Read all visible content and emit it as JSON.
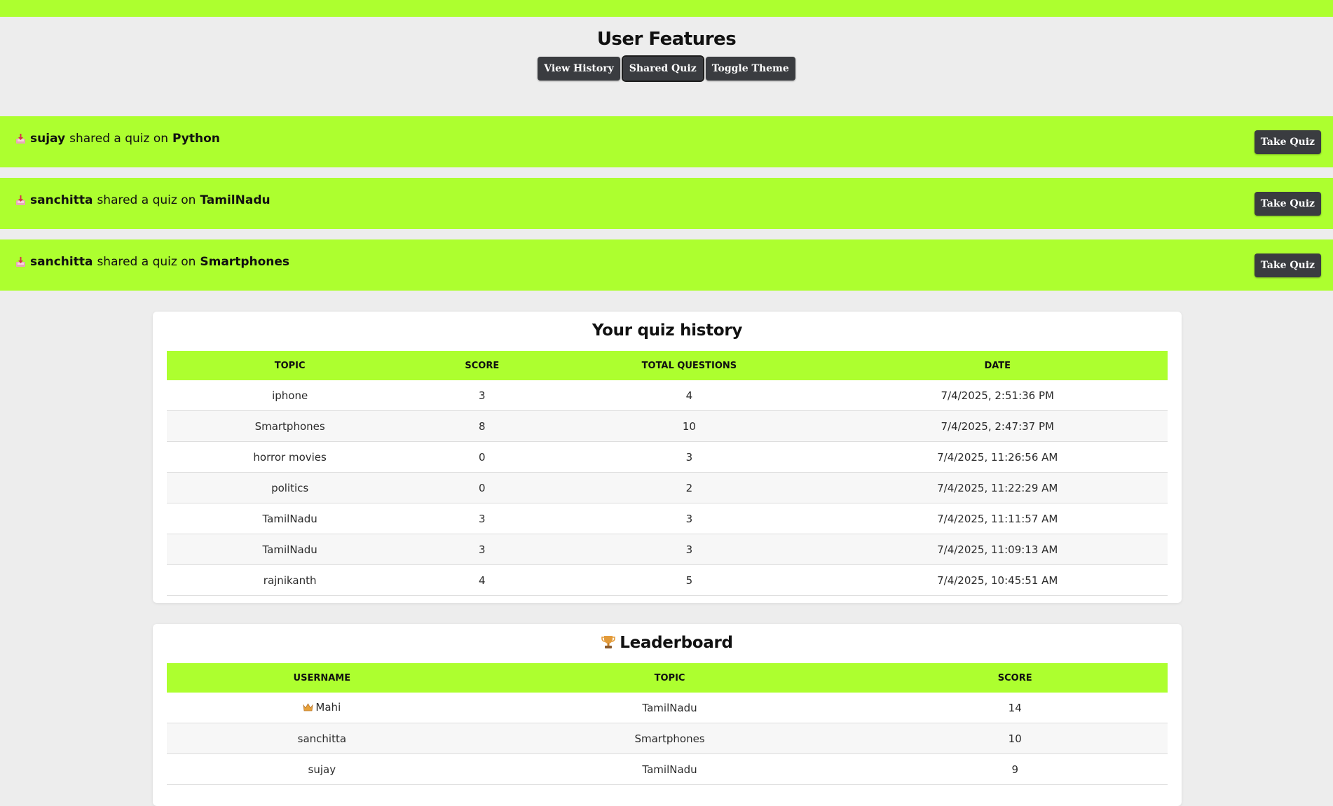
{
  "features": {
    "title": "User Features",
    "buttons": {
      "view_history": "View History",
      "shared_quiz": "Shared Quiz",
      "toggle_theme": "Toggle Theme"
    }
  },
  "shared_quizzes": [
    {
      "user": "sujay",
      "middle": "shared a quiz on",
      "topic": "Python",
      "action": "Take Quiz"
    },
    {
      "user": "sanchitta",
      "middle": "shared a quiz on",
      "topic": "TamilNadu",
      "action": "Take Quiz"
    },
    {
      "user": "sanchitta",
      "middle": "shared a quiz on",
      "topic": "Smartphones",
      "action": "Take Quiz"
    }
  ],
  "history": {
    "title": "Your quiz history",
    "columns": [
      "TOPIC",
      "SCORE",
      "TOTAL QUESTIONS",
      "DATE"
    ],
    "rows": [
      [
        "iphone",
        "3",
        "4",
        "7/4/2025, 2:51:36 PM"
      ],
      [
        "Smartphones",
        "8",
        "10",
        "7/4/2025, 2:47:37 PM"
      ],
      [
        "horror movies",
        "0",
        "3",
        "7/4/2025, 11:26:56 AM"
      ],
      [
        "politics",
        "0",
        "2",
        "7/4/2025, 11:22:29 AM"
      ],
      [
        "TamilNadu",
        "3",
        "3",
        "7/4/2025, 11:11:57 AM"
      ],
      [
        "TamilNadu",
        "3",
        "3",
        "7/4/2025, 11:09:13 AM"
      ],
      [
        "rajnikanth",
        "4",
        "5",
        "7/4/2025, 10:45:51 AM"
      ]
    ]
  },
  "leaderboard": {
    "title": "Leaderboard",
    "columns": [
      "USERNAME",
      "TOPIC",
      "SCORE"
    ],
    "rows": [
      [
        "Mahi",
        "TamilNadu",
        "14"
      ],
      [
        "sanchitta",
        "Smartphones",
        "10"
      ],
      [
        "sujay",
        "TamilNadu",
        "9"
      ]
    ]
  },
  "colors": {
    "accent": "#adff2f",
    "button": "#3a3c40",
    "background": "#ededed"
  },
  "icons": {
    "share": "inbox-tray-icon",
    "leaderboard": "trophy-icon",
    "top_rank": "crown-icon"
  }
}
